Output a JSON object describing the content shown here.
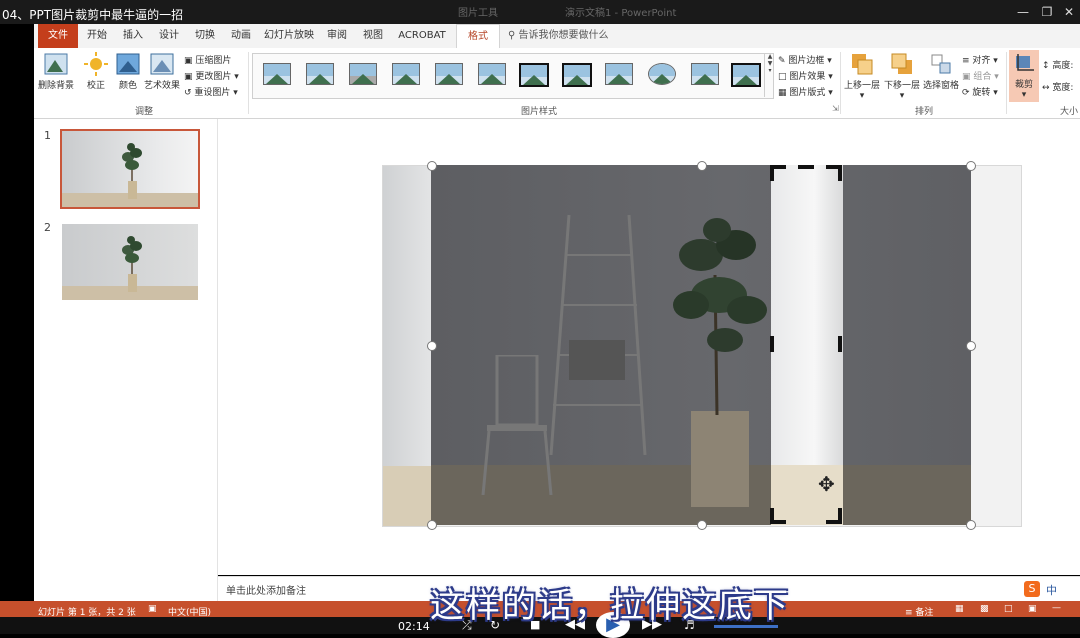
{
  "title": "04、PPT图片裁剪中最牛逼的一招",
  "title_ghost_left": "图片工具",
  "title_ghost_mid": "演示文稿1 - PowerPoint",
  "tabs": [
    "文件",
    "开始",
    "插入",
    "设计",
    "切换",
    "动画",
    "幻灯片放映",
    "审阅",
    "视图",
    "ACROBAT",
    "格式"
  ],
  "tell_me": "告诉我你想要做什么",
  "ribbon": {
    "remove_bg": "删除背景",
    "correct": "校正",
    "color": "颜色",
    "art_effects": "艺术效果",
    "compress": "压缩图片",
    "change_pic": "更改图片",
    "reset_pic": "重设图片",
    "group_adjust": "调整",
    "group_styles": "图片样式",
    "pic_border": "图片边框",
    "pic_effects": "图片效果",
    "pic_layout": "图片版式",
    "bring_forward": "上移一层",
    "send_backward": "下移一层",
    "selection_pane": "选择窗格",
    "align": "对齐",
    "group": "组合",
    "rotate": "旋转",
    "group_arrange": "排列",
    "crop": "裁剪",
    "height": "高度:",
    "width": "宽度:",
    "group_size": "大小"
  },
  "slides": [
    "1",
    "2"
  ],
  "notes_placeholder": "单击此处添加备注",
  "status": {
    "slide_info": "幻灯片 第 1 张，共 2 张",
    "language": "中文(中国)",
    "notes": "备注",
    "zoom_label": "中"
  },
  "subtitle": "这样的话，拉伸这底下",
  "player_time": "02:14",
  "colors": {
    "accent": "#c43e1c",
    "status": "#c6502c"
  }
}
